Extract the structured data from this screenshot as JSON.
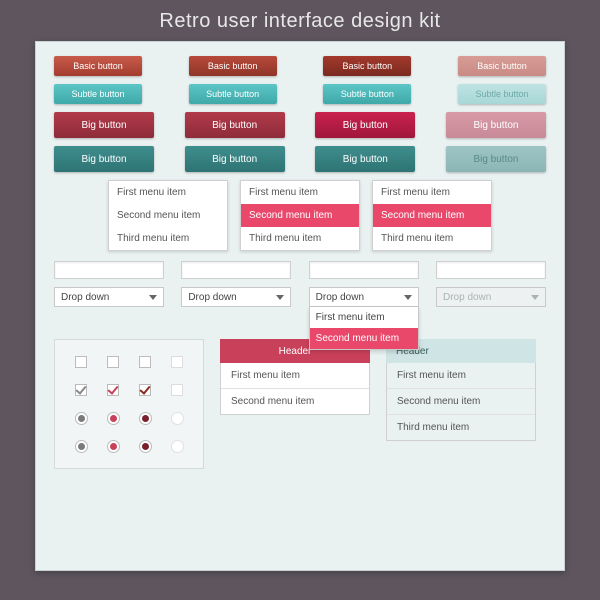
{
  "title": "Retro user interface design kit",
  "buttons": {
    "basic": [
      "Basic button",
      "Basic button",
      "Basic button",
      "Basic button"
    ],
    "subtle": [
      "Subtle button",
      "Subtle button",
      "Subtle button",
      "Subtle button"
    ],
    "big_row1": [
      "Big button",
      "Big button",
      "Big button",
      "Big button"
    ],
    "big_row2": [
      "Big button",
      "Big button",
      "Big button",
      "Big button"
    ]
  },
  "menus": [
    {
      "items": [
        "First menu item",
        "Second menu item",
        "Third menu item"
      ],
      "highlight": -1
    },
    {
      "items": [
        "First menu item",
        "Second menu item",
        "Third menu item"
      ],
      "highlight": 1
    },
    {
      "items": [
        "First menu item",
        "Second menu item",
        "Third menu item"
      ],
      "highlight": 1
    }
  ],
  "dropdowns": {
    "label": "Drop down",
    "open_items": [
      "First menu item",
      "Second menu item"
    ],
    "open_highlight": 1
  },
  "checks": {
    "row1": [
      false,
      false,
      false,
      false
    ],
    "row2": [
      true,
      true,
      true,
      false
    ]
  },
  "radios": {
    "row1": [
      true,
      true,
      true,
      false
    ],
    "row2": [
      true,
      true,
      true,
      false
    ]
  },
  "listboxes": {
    "pink": {
      "header": "Header",
      "items": [
        "First menu item",
        "Second menu item"
      ]
    },
    "teal": {
      "header": "Header",
      "items": [
        "First menu item",
        "Second menu item",
        "Third menu item"
      ]
    }
  }
}
